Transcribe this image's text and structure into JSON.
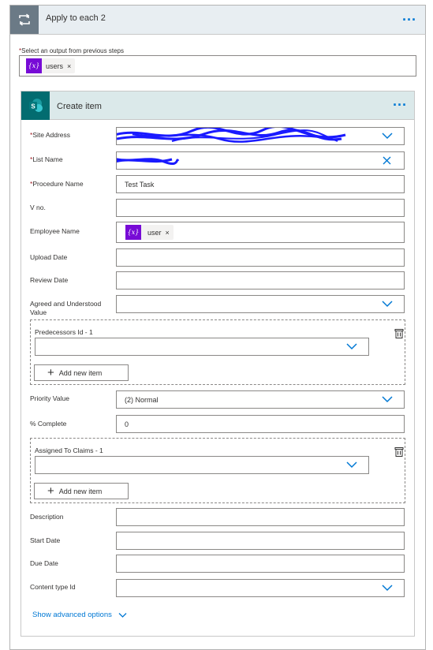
{
  "apply_each": {
    "title": "Apply to each 2",
    "more_icon": "ellipsis-icon",
    "select_label": "Select an output from previous steps",
    "required_mark": "*",
    "token": {
      "icon": "{x}",
      "label": "users",
      "remove": "×"
    }
  },
  "create_item": {
    "title": "Create item",
    "more_icon": "ellipsis-icon",
    "fields": {
      "site_address": {
        "label": "Site Address",
        "required": "*",
        "value": ""
      },
      "list_name": {
        "label": "List Name",
        "required": "*",
        "value": ""
      },
      "procedure_name": {
        "label": "Procedure Name",
        "required": "*",
        "value": "Test Task"
      },
      "v_no": {
        "label": "V no.",
        "value": ""
      },
      "employee_name": {
        "label": "Employee Name",
        "token": {
          "icon": "{x}",
          "label": "user",
          "remove": "×"
        }
      },
      "upload_date": {
        "label": "Upload Date",
        "value": ""
      },
      "review_date": {
        "label": "Review Date",
        "value": ""
      },
      "agreed_value": {
        "label_line1": "Agreed and Understood",
        "label_line2": "Value",
        "value": ""
      },
      "predecessors": {
        "label": "Predecessors Id - 1",
        "add_label": "Add new item"
      },
      "priority_value": {
        "label": "Priority Value",
        "value": "(2) Normal"
      },
      "percent_complete": {
        "label": "% Complete",
        "value": "0"
      },
      "assigned_to": {
        "label": "Assigned To Claims - 1",
        "add_label": "Add new item"
      },
      "description": {
        "label": "Description",
        "value": ""
      },
      "start_date": {
        "label": "Start Date",
        "value": ""
      },
      "due_date": {
        "label": "Due Date",
        "value": ""
      },
      "content_type_id": {
        "label": "Content type Id",
        "value": ""
      }
    },
    "advanced_label": "Show advanced options"
  },
  "colors": {
    "accent": "#0078d4",
    "loop_icon_bg": "#6b7a86",
    "sharepoint_bg": "#036c70",
    "token_purple": "#770bd6",
    "redaction_blue": "#1a1aff"
  }
}
